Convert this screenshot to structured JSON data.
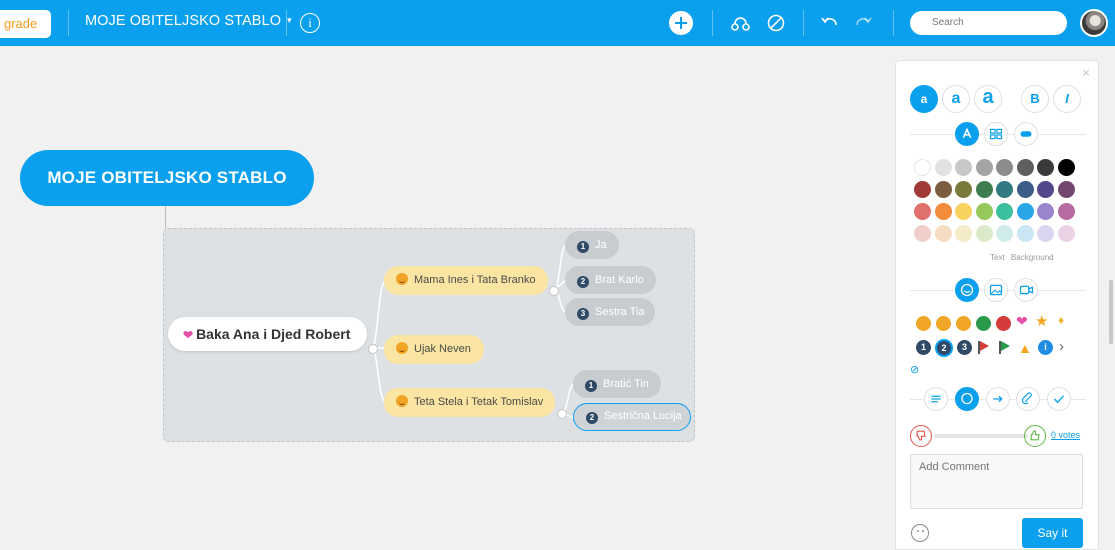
{
  "topbar": {
    "upgrade_label": "grade",
    "map_title": "MOJE OBITELJSKO STABLO",
    "caret": "▾",
    "info_icon": "i",
    "search_placeholder": "Search"
  },
  "mindmap": {
    "root": "MOJE OBITELJSKO STABLO",
    "parent": "Baka Ana i Djed Robert",
    "children": [
      {
        "label": "Mama Ines i Tata Branko"
      },
      {
        "label": "Ujak Neven"
      },
      {
        "label": "Teta Stela i Tetak Tomislav"
      }
    ],
    "grandchildren_mama": [
      {
        "num": "1",
        "label": "Ja"
      },
      {
        "num": "2",
        "label": "Brat Karlo"
      },
      {
        "num": "3",
        "label": "Sestra Tia"
      }
    ],
    "grandchildren_teta": [
      {
        "num": "1",
        "label": "Bratić Tin"
      },
      {
        "num": "2",
        "label": "Sestrična Lucija"
      }
    ]
  },
  "panel": {
    "close_glyph": "×",
    "font_sizes": [
      "a",
      "a",
      "a"
    ],
    "bold": "B",
    "italic": "I",
    "color_labels": [
      "Text",
      "Background"
    ],
    "color_rows": [
      [
        "#ffffff",
        "#e2e2e2",
        "#c7c7c7",
        "#a4a4a4",
        "#8c8c8c",
        "#5f5f5f",
        "#3a3a3a",
        "#000000"
      ],
      [
        "#a13b35",
        "#7b5d40",
        "#7a7a3c",
        "#3e7d4f",
        "#327a82",
        "#3a5c86",
        "#54478b",
        "#75476f"
      ],
      [
        "#e0706b",
        "#f08c3a",
        "#f7d25f",
        "#96c85a",
        "#3bbf9e",
        "#2aa6e8",
        "#9b86cd",
        "#b66a9f"
      ],
      [
        "#f0cfcb",
        "#f5dcc3",
        "#f4ecc9",
        "#dbeacb",
        "#cfecea",
        "#cbe6f5",
        "#dcd5ef",
        "#ecd2e5"
      ]
    ],
    "marker_more": "›",
    "no_marker": "⊘",
    "votes_link": "0 votes",
    "comment_placeholder": "Add Comment",
    "say_it": "Say it"
  }
}
